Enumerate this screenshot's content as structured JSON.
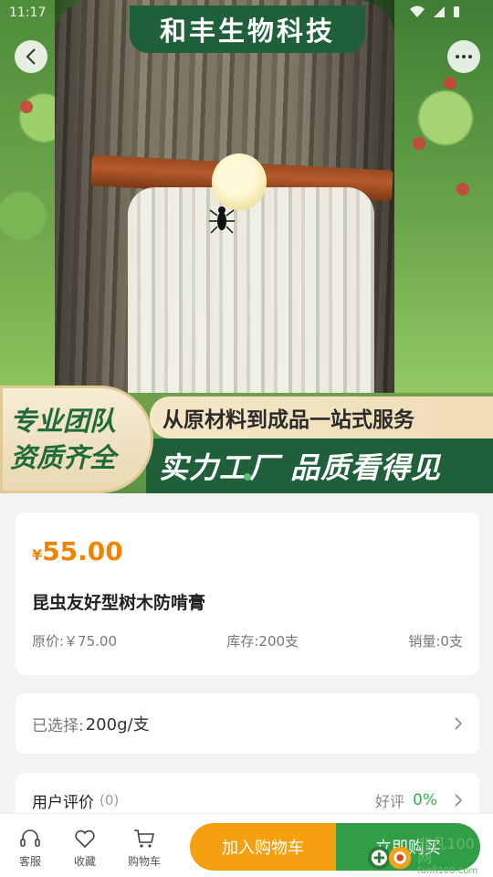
{
  "status_bar": {
    "time": "11:17"
  },
  "banner": {
    "company": "和丰生物科技",
    "badge_line1": "专业团队",
    "badge_line2": "资质齐全",
    "slogan_top": "从原材料到成品一站式服务",
    "slogan_bottom": "实力工厂  品质看得见"
  },
  "product": {
    "currency": "¥",
    "price": "55.00",
    "name": "昆虫友好型树木防啃膏",
    "original_price": "原价:￥75.00",
    "stock": "库存:200支",
    "sales": "销量:0支"
  },
  "spec": {
    "label": "已选择:",
    "value": "200g/支"
  },
  "reviews": {
    "title": "用户评价",
    "count": "(0)",
    "good_label": "好评",
    "good_rate": "0%"
  },
  "bottom_bar": {
    "service": "客服",
    "favorite": "收藏",
    "cart": "购物车",
    "add_to_cart": "加入购物车",
    "buy_now": "立即购买"
  },
  "watermark": {
    "text": "非凡100网",
    "sub": "fanfi100.com"
  },
  "colors": {
    "accent_orange": "#f08300",
    "brand_green": "#1f5f3a",
    "buy_green": "#2f9e46",
    "cart_orange": "#f5a011"
  }
}
